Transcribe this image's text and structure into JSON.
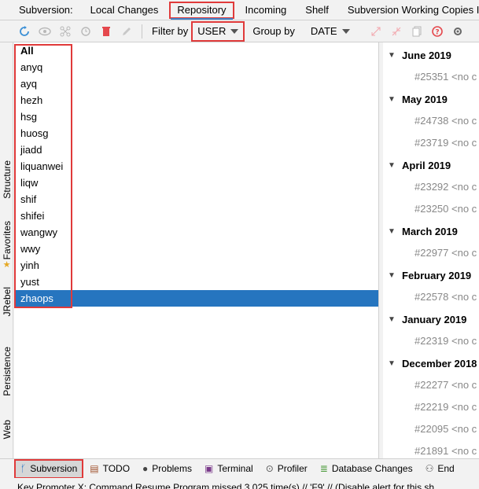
{
  "tabbar": {
    "prefix": "Subversion:",
    "tabs": [
      {
        "label": "Local Changes"
      },
      {
        "label": "Repository"
      },
      {
        "label": "Incoming"
      },
      {
        "label": "Shelf"
      },
      {
        "label": "Subversion Working Copies In"
      }
    ],
    "active_index": 1
  },
  "toolbar": {
    "filter_label": "Filter by",
    "filter_value": "USER",
    "group_label": "Group by",
    "group_value": "DATE",
    "icons": [
      "refresh-icon",
      "eye-icon",
      "graph-icon",
      "revert-icon",
      "delete-icon",
      "edit-icon"
    ],
    "right_icons": [
      "expand-icon",
      "collapse-icon",
      "copy-icon",
      "help-icon",
      "settings-icon"
    ]
  },
  "left_stripe": [
    {
      "label": "Structure",
      "icon": "structure-icon"
    },
    {
      "label": "Favorites",
      "icon": "star-icon"
    },
    {
      "label": "JRebel",
      "icon": "jrebel-icon"
    },
    {
      "label": "Persistence",
      "icon": "persistence-icon"
    },
    {
      "label": "Web",
      "icon": "web-icon"
    }
  ],
  "users": [
    "All",
    "anyq",
    "ayq",
    "hezh",
    "hsg",
    "huosg",
    "jiadd",
    "liquanwei",
    "liqw",
    "shif",
    "shifei",
    "wangwy",
    "wwy",
    "yinh",
    "yust",
    "zhaops"
  ],
  "selected_user": "zhaops",
  "date_groups": [
    {
      "label": "June 2019",
      "revs": [
        "#25351"
      ]
    },
    {
      "label": "May 2019",
      "revs": [
        "#24738",
        "#23719"
      ]
    },
    {
      "label": "April 2019",
      "revs": [
        "#23292",
        "#23250"
      ]
    },
    {
      "label": "March 2019",
      "revs": [
        "#22977"
      ]
    },
    {
      "label": "February 2019",
      "revs": [
        "#22578"
      ]
    },
    {
      "label": "January 2019",
      "revs": [
        "#22319"
      ]
    },
    {
      "label": "December 2018",
      "revs": [
        "#22277",
        "#22219",
        "#22095",
        "#21891"
      ]
    }
  ],
  "rev_suffix": "<no c",
  "bottom_tabs": [
    {
      "label": "Subversion",
      "icon": "subversion-icon"
    },
    {
      "label": "TODO",
      "icon": "todo-icon"
    },
    {
      "label": "Problems",
      "icon": "problems-icon"
    },
    {
      "label": "Terminal",
      "icon": "terminal-icon"
    },
    {
      "label": "Profiler",
      "icon": "profiler-icon"
    },
    {
      "label": "Database Changes",
      "icon": "database-icon"
    },
    {
      "label": "End",
      "icon": "endpoints-icon"
    }
  ],
  "status_text": "Key Promoter X: Command Resume Program missed 3,025 time(s) // 'F9' // (Disable alert for this sh",
  "colors": {
    "accent": "#2675bf",
    "highlight": "#e03a3a",
    "tab_underline": "#4083c9"
  }
}
